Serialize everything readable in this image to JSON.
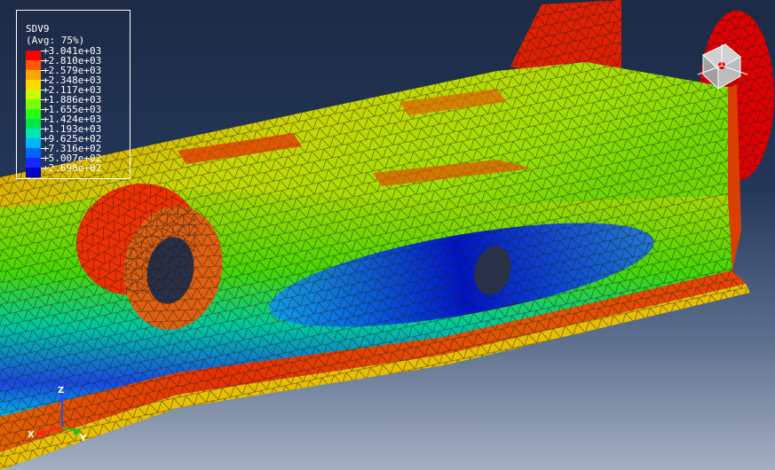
{
  "legend": {
    "variable": "SDV9",
    "averaging": "(Avg: 75%)",
    "entries": [
      {
        "label": "+3.041e+03",
        "color": "#ff0000"
      },
      {
        "label": "+2.810e+03",
        "color": "#ff5a00"
      },
      {
        "label": "+2.579e+03",
        "color": "#ffa500"
      },
      {
        "label": "+2.348e+03",
        "color": "#ffd800"
      },
      {
        "label": "+2.117e+03",
        "color": "#c8ff00"
      },
      {
        "label": "+1.886e+03",
        "color": "#78ff00"
      },
      {
        "label": "+1.655e+03",
        "color": "#28ff14"
      },
      {
        "label": "+1.424e+03",
        "color": "#00e646"
      },
      {
        "label": "+1.193e+03",
        "color": "#00e6b4"
      },
      {
        "label": "+9.625e+02",
        "color": "#00b4ff"
      },
      {
        "label": "+7.316e+02",
        "color": "#0064ff"
      },
      {
        "label": "+5.007e+02",
        "color": "#1428ff"
      },
      {
        "label": "+2.698e+02",
        "color": "#0000c8"
      }
    ]
  },
  "triad": {
    "x_label": "X",
    "y_label": "Y",
    "z_label": "Z",
    "x_color": "#ff2020",
    "y_color": "#20c020",
    "z_color": "#2050ff"
  },
  "view_cube": {
    "icon": "view-cube-icon"
  },
  "model": {
    "description_icon": "fea-mesh-contour"
  }
}
